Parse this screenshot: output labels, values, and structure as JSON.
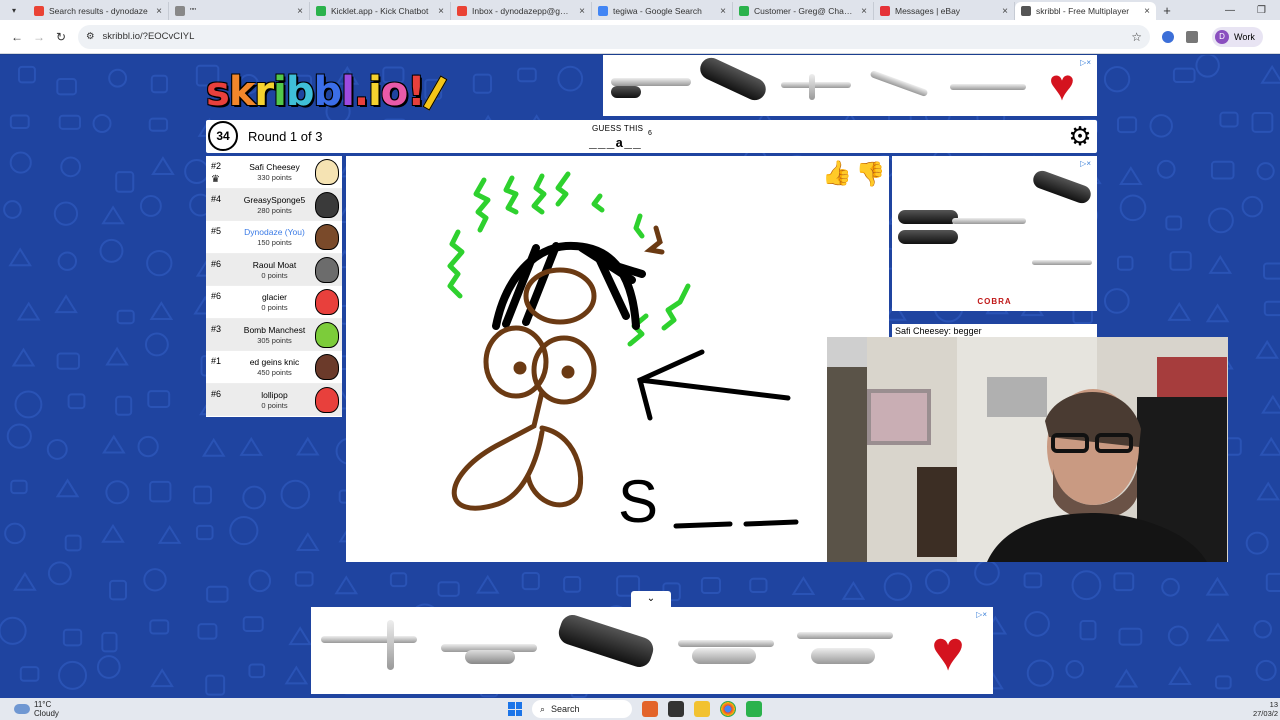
{
  "browser": {
    "tabs": [
      {
        "label": "Search results - dynodaze",
        "favicon_color": "#ea4335"
      },
      {
        "label": "\"\"",
        "favicon_color": "#888888"
      },
      {
        "label": "Kicklet.app - Kick Chatbot",
        "favicon_color": "#2bb24c"
      },
      {
        "label": "Inbox - dynodazepp@gmail",
        "favicon_color": "#ea4335"
      },
      {
        "label": "tegiwa - Google Search",
        "favicon_color": "#4285f4"
      },
      {
        "label": "Customer - Greg@ Change",
        "favicon_color": "#2bb24c"
      },
      {
        "label": "Messages | eBay",
        "favicon_color": "#e53238"
      },
      {
        "label": "skribbl - Free Multiplayer",
        "favicon_color": "#555555"
      }
    ],
    "active_tab": 7,
    "url": "skribbl.io/?EOCvCIYL",
    "profile_initial": "D",
    "profile_label": "Work"
  },
  "game": {
    "logo_letters": [
      {
        "ch": "s",
        "color": "#e8403c"
      },
      {
        "ch": "k",
        "color": "#f2872b"
      },
      {
        "ch": "r",
        "color": "#f5d22f"
      },
      {
        "ch": "i",
        "color": "#52c84a"
      },
      {
        "ch": "b",
        "color": "#3fbfd8"
      },
      {
        "ch": "b",
        "color": "#3b6ee8"
      },
      {
        "ch": "l",
        "color": "#9d4ae0"
      },
      {
        "ch": ".",
        "color": "#e8403c"
      },
      {
        "ch": "i",
        "color": "#f5d22f"
      },
      {
        "ch": "o",
        "color": "#e85aa8"
      },
      {
        "ch": "!",
        "color": "#e8403c"
      }
    ],
    "timer": "34",
    "round_text": "Round 1 of 3",
    "guess_title": "GUESS THIS",
    "hint": "___a__",
    "hint_count": "6",
    "players": [
      {
        "rank": "#2",
        "name": "Safi Cheesey",
        "points": "330 points",
        "you": false,
        "avatar_color": "#f5e3b3",
        "crown": true
      },
      {
        "rank": "#4",
        "name": "GreasySponge5",
        "points": "280 points",
        "you": false,
        "avatar_color": "#3a3a3a",
        "crown": false
      },
      {
        "rank": "#5",
        "name": "Dynodaze (You)",
        "points": "150 points",
        "you": true,
        "avatar_color": "#7a4a2a",
        "crown": false
      },
      {
        "rank": "#6",
        "name": "Raoul Moat",
        "points": "0 points",
        "you": false,
        "avatar_color": "#6c6c6c",
        "crown": false
      },
      {
        "rank": "#6",
        "name": "glacier",
        "points": "0 points",
        "you": false,
        "avatar_color": "#e8403c",
        "crown": false
      },
      {
        "rank": "#3",
        "name": "Bomb Manchest",
        "points": "305 points",
        "you": false,
        "avatar_color": "#7ccc3a",
        "crown": false
      },
      {
        "rank": "#1",
        "name": "ed geins knic",
        "points": "450 points",
        "you": false,
        "avatar_color": "#6b3a2a",
        "crown": false
      },
      {
        "rank": "#6",
        "name": "lollipop",
        "points": "0 points",
        "you": false,
        "avatar_color": "#e8403c",
        "crown": false
      }
    ],
    "canvas_text": "S",
    "chat_message": {
      "author": "Safi Cheesey",
      "text": "begger"
    },
    "ad_brand": "COBRA"
  },
  "taskbar": {
    "temperature": "11°C",
    "weather": "Cloudy",
    "search_label": "Search",
    "time": "13",
    "date": "27/03/2"
  }
}
